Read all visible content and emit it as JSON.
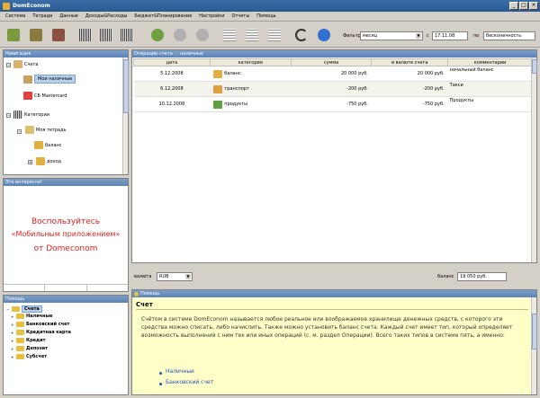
{
  "window": {
    "title": "DomEconom",
    "min": "_",
    "max": "□",
    "close": "×"
  },
  "menu": [
    "Система",
    "Тетради",
    "Данные",
    "Доходы&Расходы",
    "Бюджет&Планирование",
    "Настройки",
    "Отчеты",
    "Помощь"
  ],
  "toolbar": {
    "filter_label": "Фильтр",
    "period_value": "месяц",
    "from_label": "с",
    "from_value": "17.11.08",
    "to_label": "по",
    "to_value": "бесконечность",
    "icons": [
      "wallet-add-icon",
      "wallet-edit-icon",
      "wallet-delete-icon",
      "barcode-icon",
      "barcode-scan-icon",
      "barcode-list-icon",
      "bag-add-icon",
      "bag-edit-icon",
      "bag-delete-icon",
      "grid-icon",
      "grid-edit-icon",
      "grid-delete-icon",
      "refresh-icon",
      "help-icon"
    ]
  },
  "navigation": {
    "header": "Навигация",
    "accounts_label": "Счета",
    "account_cash": "Мои наличные",
    "account_card": "СБ Mastercard",
    "categories_label": "Категории",
    "notebook_label": "Моя тетрадь",
    "balance_label": "баланс",
    "income_label": "доход"
  },
  "promo": {
    "header": "Это интересно!",
    "line1": "Воспользуйтесь",
    "line2": "«Мобильным приложением»",
    "line3": "от Domeconom"
  },
  "help_tree": {
    "header": "Помощь",
    "items": [
      "Счета",
      "Наличные",
      "Банковский счет",
      "Кредитная карта",
      "Кредит",
      "Депозит",
      "Субсчет"
    ]
  },
  "operations": {
    "header": "Операции счета : - наличные",
    "columns": [
      "дата",
      "категория",
      "сумма",
      "в валюте счета",
      "комментарии"
    ],
    "rows": [
      {
        "date": "5.12.2008",
        "category": "баланс",
        "amount": "20 000 руб.",
        "account_amount": "20 000 руб.",
        "comment": "начальный баланс"
      },
      {
        "date": "6.12.2008",
        "category": "транспорт",
        "amount": "-200 руб.",
        "account_amount": "-200 руб.",
        "comment": "Такси"
      },
      {
        "date": "10.12.2008",
        "category": "продукты",
        "amount": "-750 руб.",
        "account_amount": "-750 руб.",
        "comment": "Продукты"
      }
    ],
    "currency_label": "валюта",
    "currency_value": "RUB",
    "balance_label": "баланс",
    "balance_value": "19 050 руб."
  },
  "help_panel": {
    "header": "Помощь",
    "title": "Счет",
    "body": "Счётом в системе DomEconom называется любое реальное или воображаемое хранилище денежных средств, с которого эти средства можно списать, либо начислить. Также можно установить баланс счета. Каждый счет имеет тип, который определяет возможность выполнения с ним тех или иных операций (с. м. раздел Операции). Всего таких типов в системе пять, а именно:",
    "links": [
      "Наличные",
      "Банковский счет"
    ]
  },
  "colors": {
    "accent": "#5b84b8",
    "help_bg": "#ffffc8",
    "promo_red": "#e02020"
  }
}
